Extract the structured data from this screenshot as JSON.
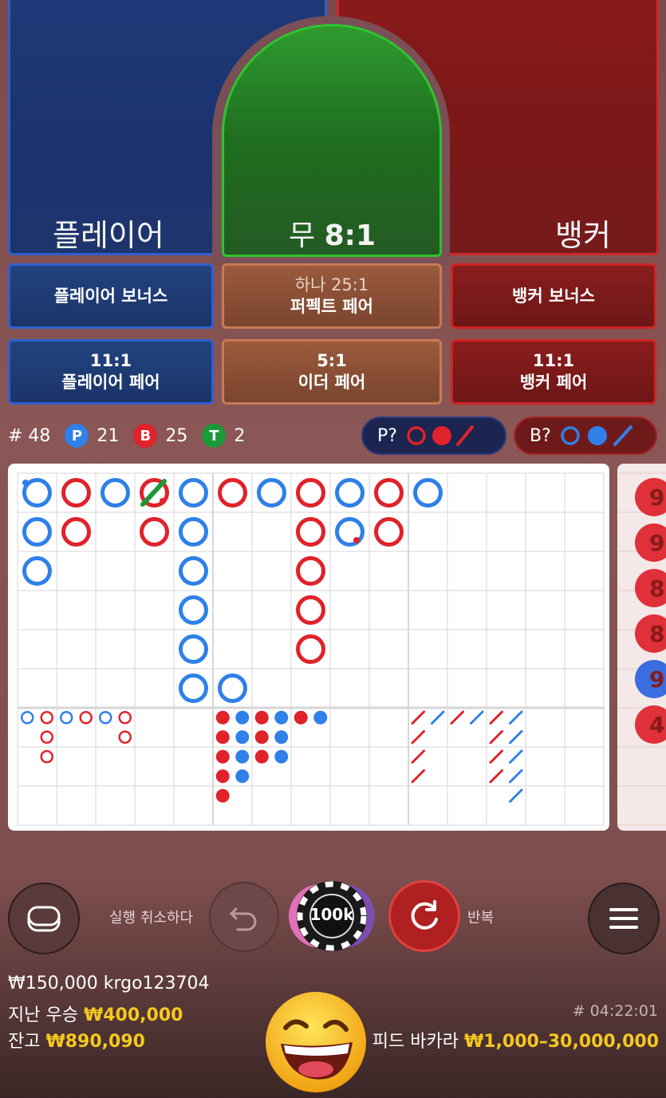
{
  "bets": {
    "player_label": "플레이어",
    "tie_label": "무",
    "tie_odds": "8:1",
    "banker_label": "뱅커"
  },
  "side_bets": {
    "player_bonus": "플레이어 보너스",
    "perfect_pair_odds": "하나 25:1",
    "perfect_pair": "퍼펙트 페어",
    "banker_bonus": "뱅커 보너스",
    "player_pair_odds": "11:1",
    "player_pair": "플레이어 페어",
    "either_pair_odds": "5:1",
    "either_pair": "이더 페어",
    "banker_pair_odds": "11:1",
    "banker_pair": "뱅커 페어"
  },
  "stats": {
    "round": "# 48",
    "player_letter": "P",
    "player_count": "21",
    "banker_letter": "B",
    "banker_count": "25",
    "tie_letter": "T",
    "tie_count": "2"
  },
  "predict": {
    "player": "P?",
    "banker": "B?"
  },
  "side_board_numbers": [
    "9",
    "9",
    "8",
    "8",
    "9",
    "4"
  ],
  "controls": {
    "undo_label": "실행 취소하다",
    "chip_value": "100k",
    "repeat_label": "반복"
  },
  "footer": {
    "balance_user": "₩150,000 krgo123704",
    "last_win_label": "지난 우승",
    "last_win_value": "₩400,000",
    "balance_label": "잔고",
    "balance_value": "₩890,090",
    "time": "# 04:22:01",
    "table_name": "피드 바카라",
    "limits": "₩1,000–30,000,000"
  },
  "colors": {
    "player": "#2f80e8",
    "banker": "#e0222a",
    "tie": "#1a9a3a",
    "gold": "#f5c820"
  }
}
